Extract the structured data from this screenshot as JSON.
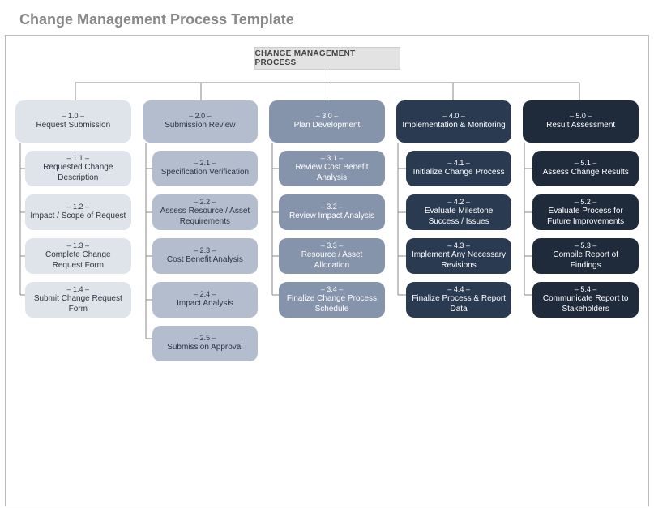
{
  "title": "Change Management Process Template",
  "root": "CHANGE MANAGEMENT PROCESS",
  "columns": [
    {
      "num": "– 1.0 –",
      "label": "Request Submission",
      "items": [
        {
          "num": "– 1.1 –",
          "label": "Requested Change Description"
        },
        {
          "num": "– 1.2 –",
          "label": "Impact / Scope of Request"
        },
        {
          "num": "– 1.3 –",
          "label": "Complete Change Request Form"
        },
        {
          "num": "– 1.4 –",
          "label": "Submit Change Request Form"
        }
      ]
    },
    {
      "num": "– 2.0 –",
      "label": "Submission Review",
      "items": [
        {
          "num": "– 2.1 –",
          "label": "Specification Verification"
        },
        {
          "num": "– 2.2 –",
          "label": "Assess Resource / Asset Requirements"
        },
        {
          "num": "– 2.3 –",
          "label": "Cost Benefit Analysis"
        },
        {
          "num": "– 2.4 –",
          "label": "Impact Analysis"
        },
        {
          "num": "– 2.5 –",
          "label": "Submission Approval"
        }
      ]
    },
    {
      "num": "– 3.0 –",
      "label": "Plan Development",
      "items": [
        {
          "num": "– 3.1 –",
          "label": "Review Cost Benefit Analysis"
        },
        {
          "num": "– 3.2 –",
          "label": "Review Impact Analysis"
        },
        {
          "num": "– 3.3 –",
          "label": "Resource / Asset Allocation"
        },
        {
          "num": "– 3.4 –",
          "label": "Finalize Change Process Schedule"
        }
      ]
    },
    {
      "num": "– 4.0 –",
      "label": "Implementation & Monitoring",
      "items": [
        {
          "num": "– 4.1 –",
          "label": "Initialize Change Process"
        },
        {
          "num": "– 4.2 –",
          "label": "Evaluate Milestone Success / Issues"
        },
        {
          "num": "– 4.3 –",
          "label": "Implement Any Necessary Revisions"
        },
        {
          "num": "– 4.4 –",
          "label": "Finalize Process & Report Data"
        }
      ]
    },
    {
      "num": "– 5.0 –",
      "label": "Result Assessment",
      "items": [
        {
          "num": "– 5.1 –",
          "label": "Assess Change Results"
        },
        {
          "num": "– 5.2 –",
          "label": "Evaluate Process for Future Improvements"
        },
        {
          "num": "– 5.3 –",
          "label": "Compile Report of Findings"
        },
        {
          "num": "– 5.4 –",
          "label": "Communicate Report to Stakeholders"
        }
      ]
    }
  ]
}
